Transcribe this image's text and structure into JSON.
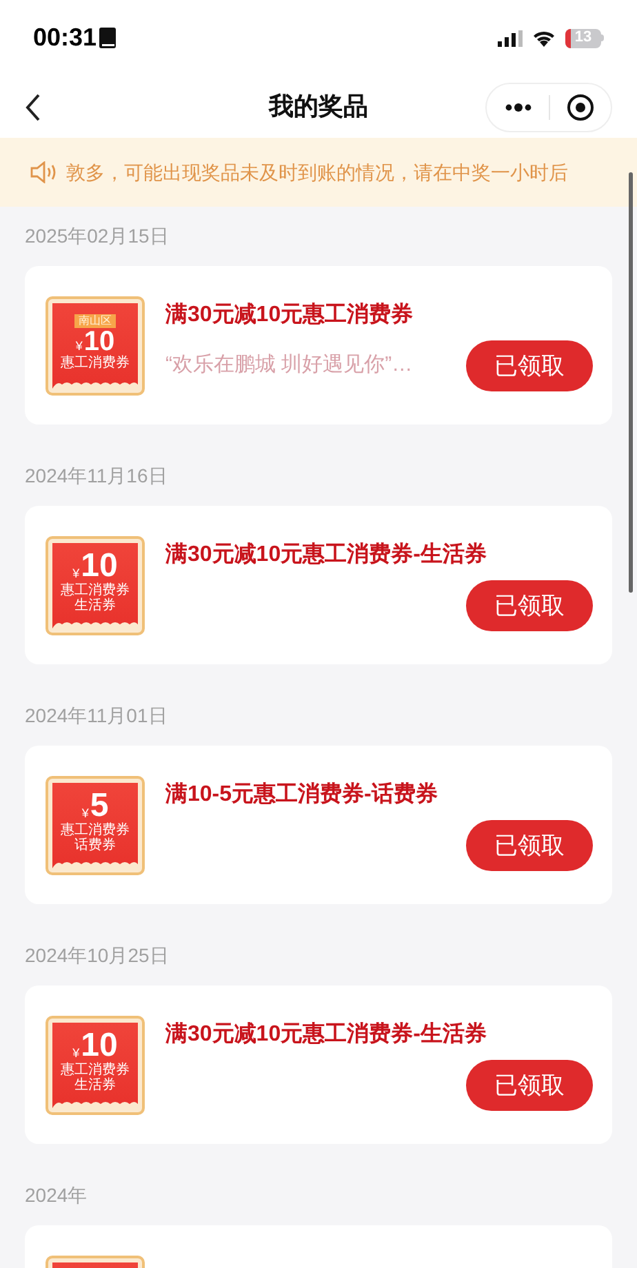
{
  "status_bar": {
    "time": "00:31",
    "battery": "13"
  },
  "nav": {
    "title": "我的奖品"
  },
  "notice": {
    "text": "敦多，可能出现奖品未及时到账的情况，请在中奖一小时后"
  },
  "groups": [
    {
      "date": "2025年02月15日",
      "prize": {
        "title": "满30元减10元惠工消费券",
        "subtitle": "“欢乐在鹏城 圳好遇见你”…",
        "button": "已领取",
        "coupon": {
          "tag": "南山区",
          "currency": "¥",
          "amount": "10",
          "lines": [
            "惠工消费券"
          ]
        }
      }
    },
    {
      "date": "2024年11月16日",
      "prize": {
        "title": "满30元减10元惠工消费券-生活券",
        "button": "已领取",
        "coupon": {
          "currency": "¥",
          "amount": "10",
          "lines": [
            "惠工消费券",
            "生活券"
          ]
        }
      }
    },
    {
      "date": "2024年11月01日",
      "prize": {
        "title": "满10-5元惠工消费券-话费券",
        "button": "已领取",
        "coupon": {
          "currency": "¥",
          "amount": "5",
          "lines": [
            "惠工消费券",
            "话费券"
          ]
        }
      }
    },
    {
      "date": "2024年10月25日",
      "prize": {
        "title": "满30元减10元惠工消费券-生活券",
        "button": "已领取",
        "coupon": {
          "currency": "¥",
          "amount": "10",
          "lines": [
            "惠工消费券",
            "生活券"
          ]
        }
      }
    },
    {
      "date": "2024年"
    }
  ]
}
